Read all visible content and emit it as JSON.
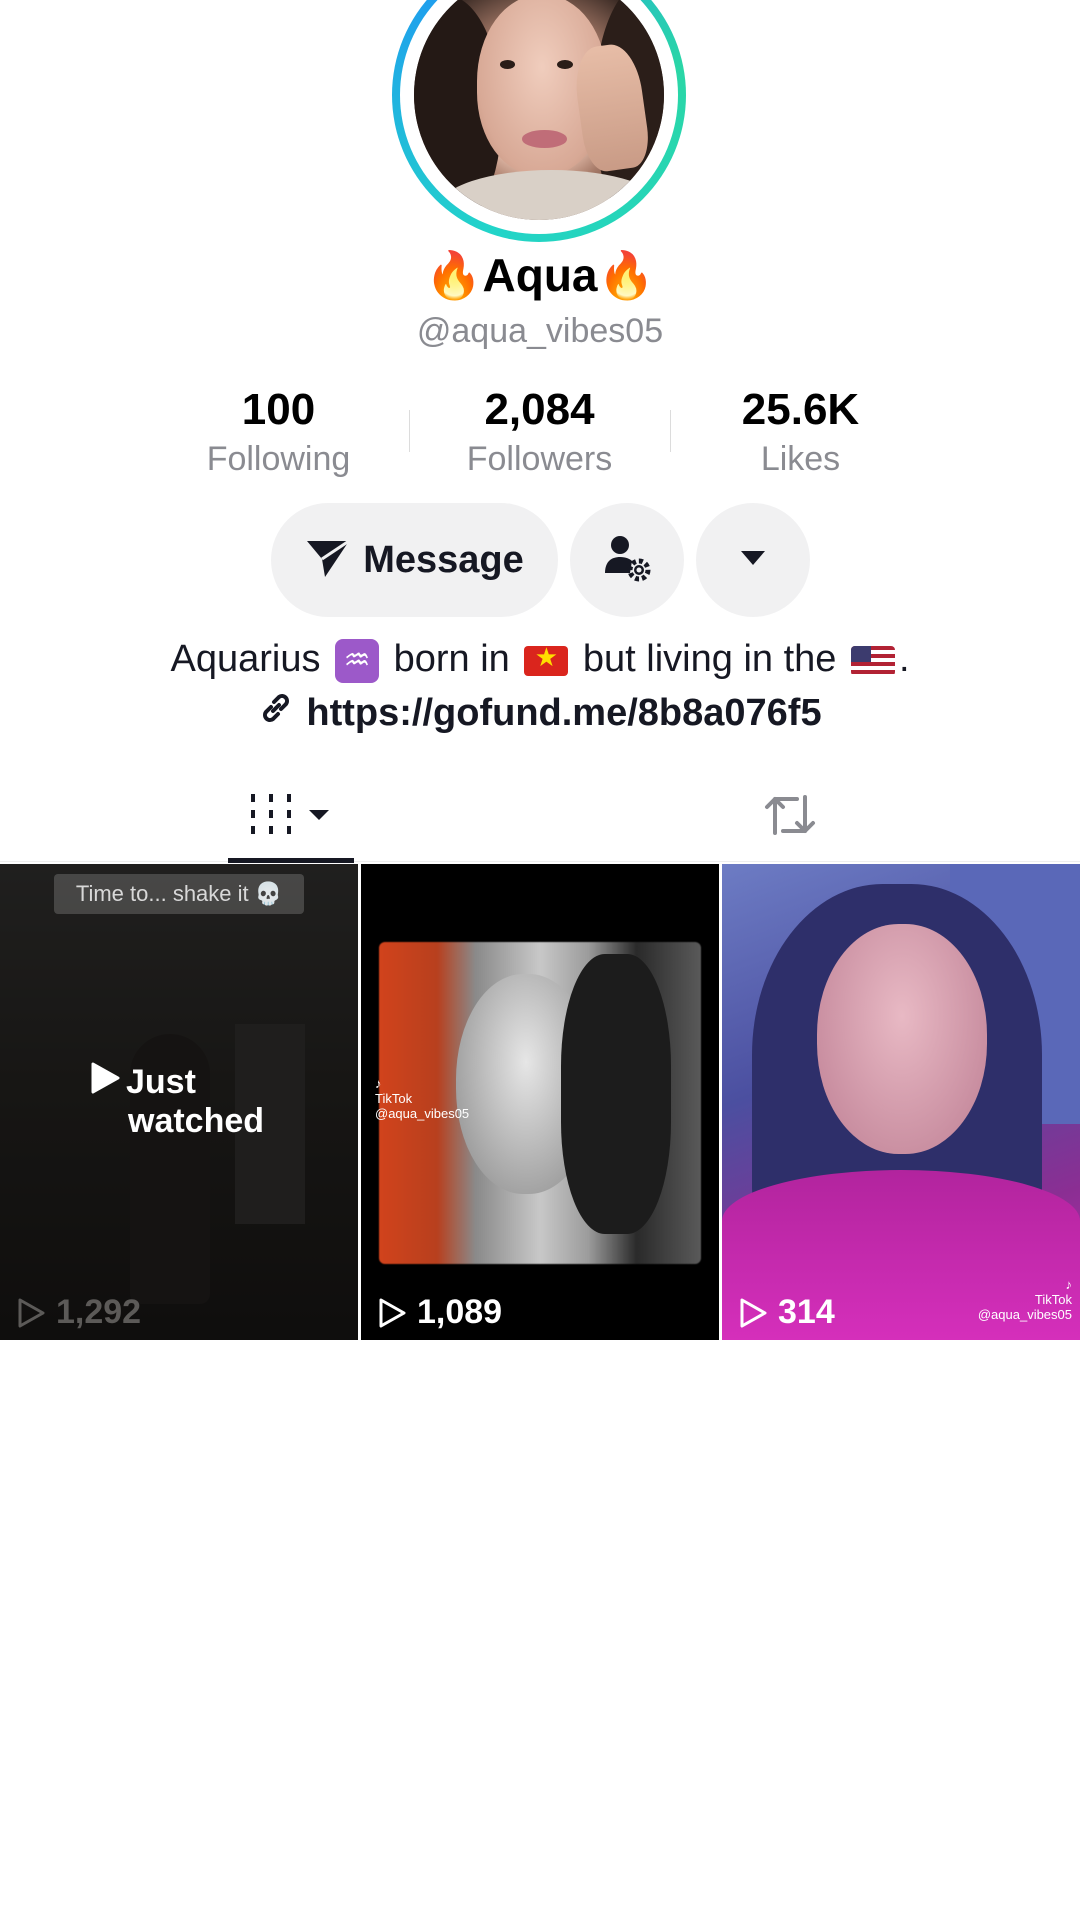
{
  "profile": {
    "display_name": "Aqua",
    "username": "@aqua_vibes05"
  },
  "stats": [
    {
      "value": "100",
      "label": "Following"
    },
    {
      "value": "2,084",
      "label": "Followers"
    },
    {
      "value": "25.6K",
      "label": "Likes"
    }
  ],
  "actions": {
    "message_label": "Message",
    "user_settings_icon": "user-gear-icon",
    "more_icon": "caret-down-icon"
  },
  "bio": {
    "part1": "Aquarius",
    "part2": "born in",
    "part3": "but living in the",
    "part4": ".",
    "link": "https://gofund.me/8b8a076f5"
  },
  "tabs": {
    "videos_icon": "grid-icon",
    "reposts_icon": "repost-icon",
    "active": "videos"
  },
  "videos": [
    {
      "views": "1,292",
      "caption": "Time to... shake it 💀",
      "status_line1": "Just",
      "status_line2": "watched"
    },
    {
      "views": "1,089",
      "watermark_brand": "TikTok",
      "watermark_user": "@aqua_vibes05"
    },
    {
      "views": "314",
      "watermark_brand": "TikTok",
      "watermark_user": "@aqua_vibes05"
    }
  ],
  "colors": {
    "avatar_ring_start": "#22d4c9",
    "avatar_ring_end": "#1f9bf0",
    "button_bg": "#f1f1f2",
    "muted_text": "#8a8b91"
  }
}
